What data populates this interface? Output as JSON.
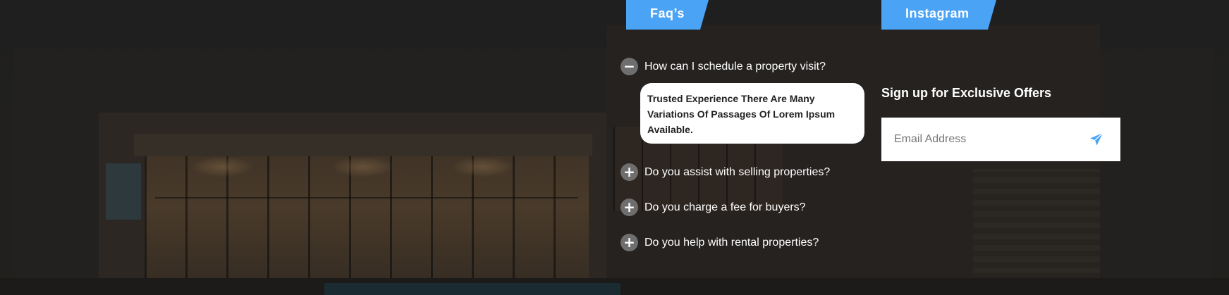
{
  "faq": {
    "tab_label": "Faq’s",
    "items": [
      {
        "question": "How can I schedule a property visit?",
        "toggle": "−",
        "expanded": true,
        "answer": "Trusted Experience There Are Many Variations Of Passages Of Lorem Ipsum Available."
      },
      {
        "question": "Do you assist with selling properties?",
        "toggle": "+",
        "expanded": false
      },
      {
        "question": "Do you charge a fee for buyers?",
        "toggle": "+",
        "expanded": false
      },
      {
        "question": "Do you help with rental properties?",
        "toggle": "+",
        "expanded": false
      }
    ]
  },
  "instagram": {
    "tab_label": "Instagram"
  },
  "newsletter": {
    "title": "Sign up for Exclusive Offers",
    "email_placeholder": "Email Address",
    "email_value": "",
    "send_icon": "paper-plane-icon"
  },
  "colors": {
    "accent": "#4aa3f5",
    "toggle_bg": "#6e6e6e",
    "background": "#262626"
  }
}
